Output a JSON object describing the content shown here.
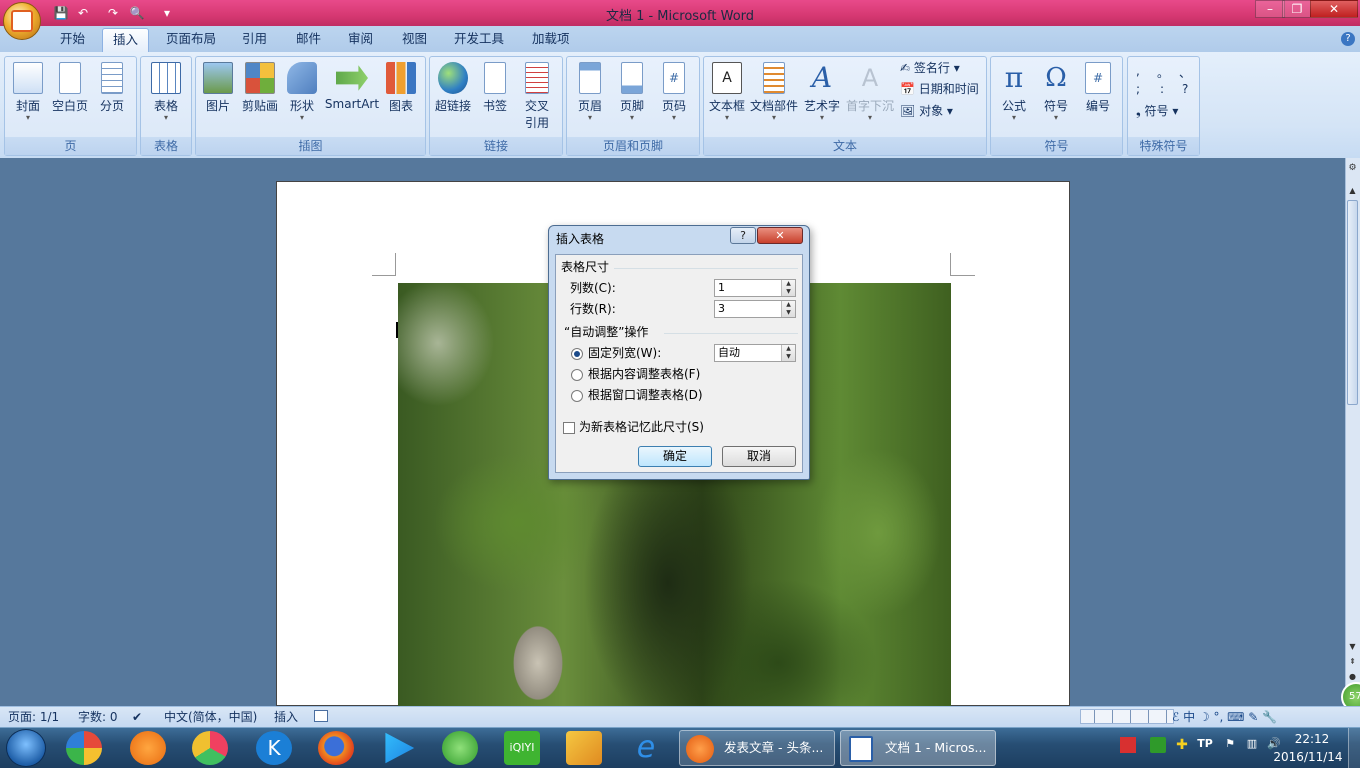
{
  "window": {
    "title": "文档 1 - Microsoft Word",
    "minimize": "–",
    "maximize": "❐",
    "close": "✕"
  },
  "tabs": [
    "开始",
    "插入",
    "页面布局",
    "引用",
    "邮件",
    "审阅",
    "视图",
    "开发工具",
    "加载项"
  ],
  "active_tab": "插入",
  "ribbon": {
    "groups": [
      {
        "title": "页",
        "buttons": [
          "封面",
          "空白页",
          "分页"
        ]
      },
      {
        "title": "表格",
        "buttons": [
          "表格"
        ]
      },
      {
        "title": "插图",
        "buttons": [
          "图片",
          "剪贴画",
          "形状",
          "SmartArt",
          "图表"
        ]
      },
      {
        "title": "链接",
        "buttons": [
          "超链接",
          "书签",
          "交叉",
          "引用"
        ]
      },
      {
        "title": "页眉和页脚",
        "buttons": [
          "页眉",
          "页脚",
          "页码"
        ]
      },
      {
        "title": "文本",
        "buttons": [
          "文本框",
          "文档部件",
          "艺术字",
          "首字下沉"
        ],
        "small": [
          "签名行",
          "日期和时间",
          "对象"
        ]
      },
      {
        "title": "符号",
        "buttons": [
          "公式",
          "符号",
          "编号"
        ]
      },
      {
        "title": "特殊符号",
        "symbols": [
          ",",
          "。",
          "、",
          ";",
          ":",
          "?"
        ],
        "small": [
          "符号"
        ]
      }
    ]
  },
  "dialog": {
    "title": "插入表格",
    "help": "?",
    "close": "✕",
    "section_size": "表格尺寸",
    "cols_label": "列数(C):",
    "cols_value": "1",
    "rows_label": "行数(R):",
    "rows_value": "3",
    "section_autofit": "“自动调整”操作",
    "fixed_label": "固定列宽(W):",
    "fixed_value": "自动",
    "fit_content": "根据内容调整表格(F)",
    "fit_window": "根据窗口调整表格(D)",
    "remember": "为新表格记忆此尺寸(S)",
    "ok": "确定",
    "cancel": "取消"
  },
  "status": {
    "page": "页面: 1/1",
    "words": "字数: 0",
    "language": "中文(简体，中国)",
    "mode": "插入"
  },
  "taskbar": {
    "apps": [
      "发表文章 - 头条...",
      "文档 1 - Micros..."
    ],
    "time": "22:12",
    "date": "2016/11/14",
    "ime": "中"
  },
  "colors": {
    "titlebar": "#d63872",
    "ribbon": "#dae7f7",
    "taskbar": "#274e74",
    "workspace": "#56789c"
  }
}
